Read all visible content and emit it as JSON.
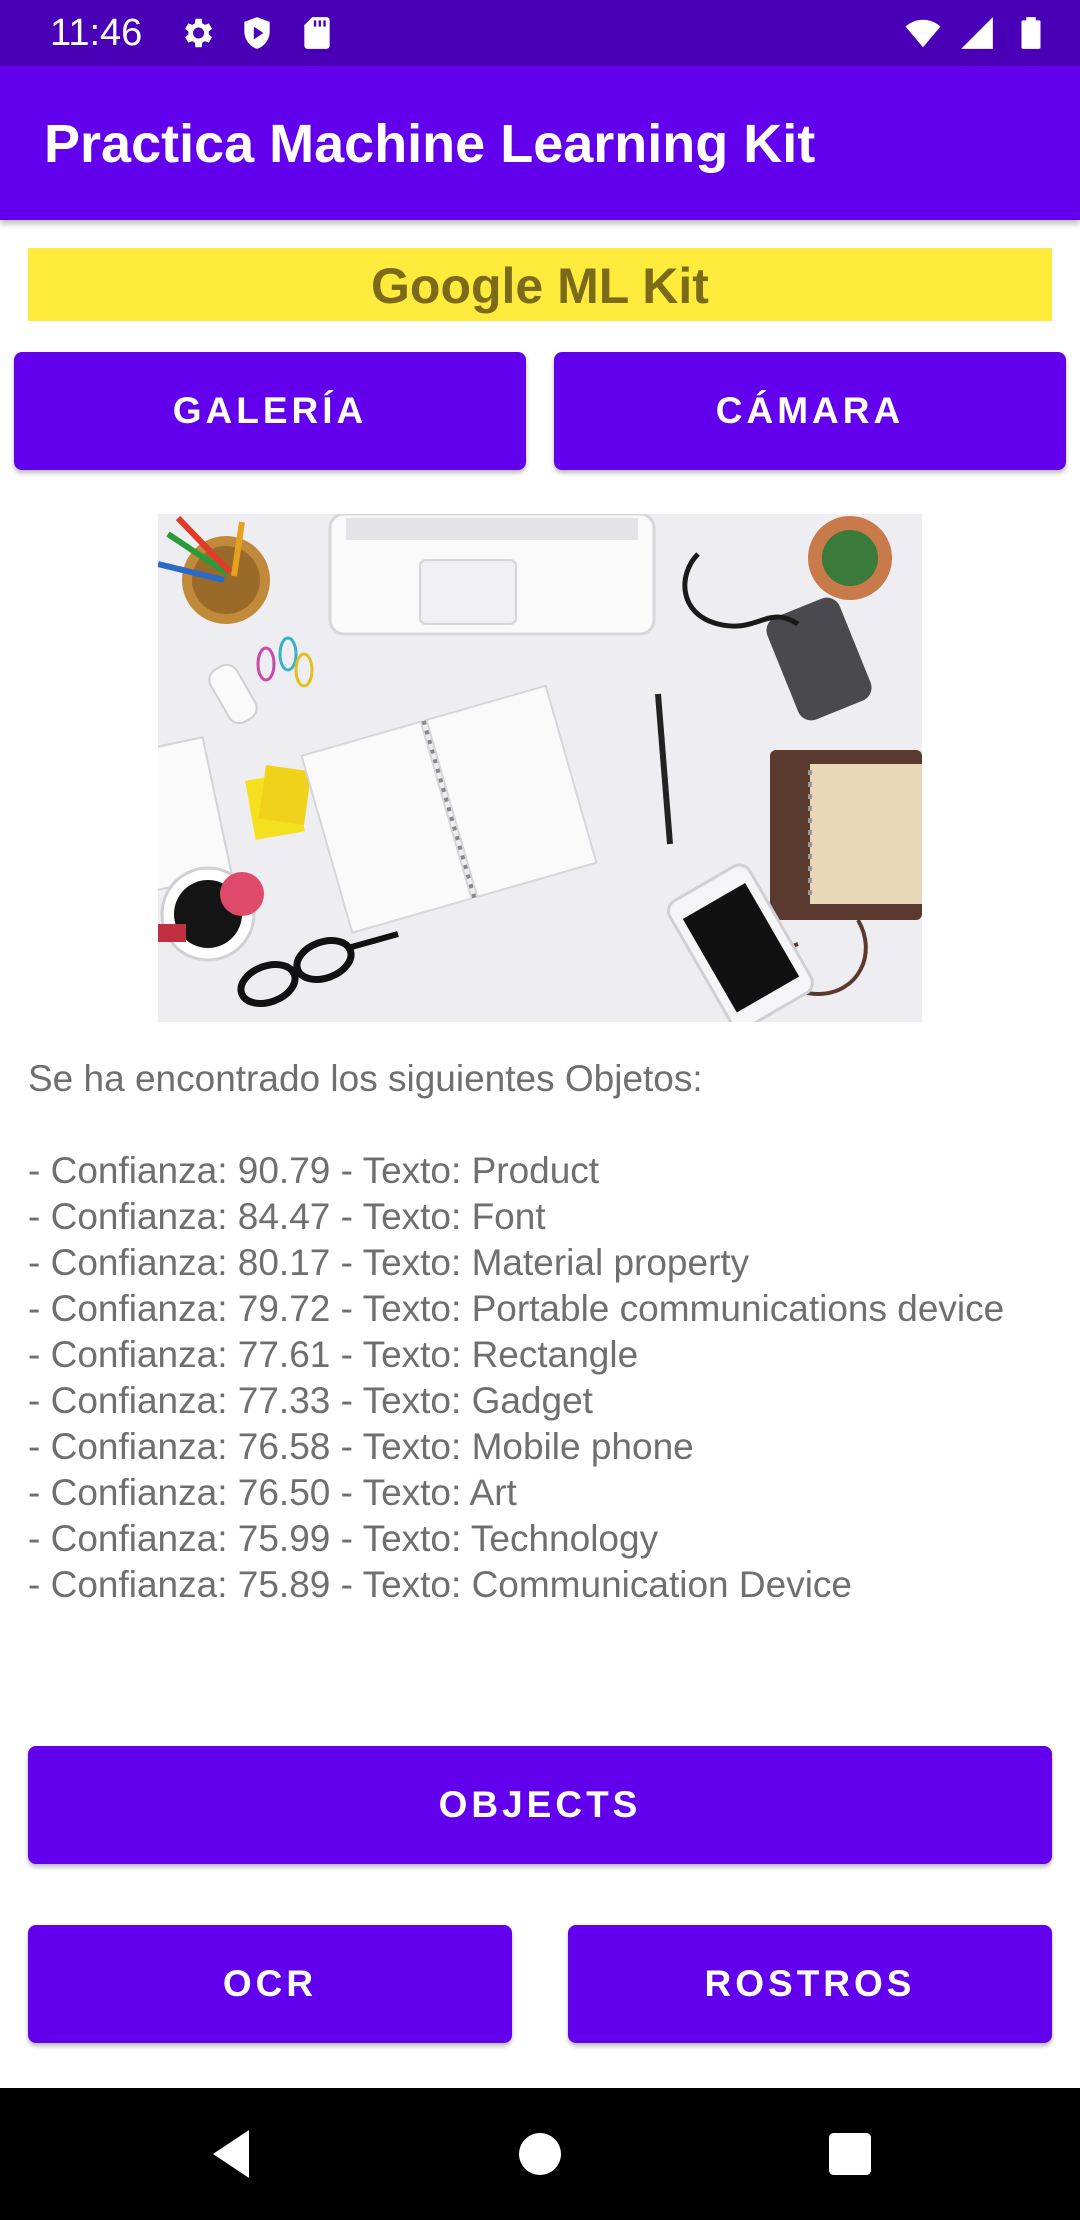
{
  "status_bar": {
    "time": "11:46",
    "left_icons": [
      "gear-icon",
      "shield-play-icon",
      "sd-card-icon"
    ],
    "right_icons": [
      "wifi-icon",
      "signal-icon",
      "battery-icon"
    ]
  },
  "app_bar": {
    "title": "Practica Machine Learning Kit"
  },
  "header": {
    "label": "Google ML Kit"
  },
  "source_buttons": {
    "gallery": "GALERÍA",
    "camera": "CÁMARA"
  },
  "results": {
    "intro": "Se ha encontrado los siguientes Objetos:",
    "lines": [
      "- Confianza: 90.79 - Texto: Product",
      "- Confianza: 84.47 - Texto: Font",
      "- Confianza: 80.17 - Texto: Material property",
      "- Confianza: 79.72 - Texto: Portable communications device",
      "- Confianza: 77.61 - Texto: Rectangle",
      "- Confianza: 77.33 - Texto: Gadget",
      "- Confianza: 76.58 - Texto: Mobile phone",
      "- Confianza: 76.50 - Texto: Art",
      "- Confianza: 75.99 - Texto: Technology",
      "- Confianza: 75.89 - Texto: Communication Device"
    ]
  },
  "action_buttons": {
    "objects": "OBJECTS",
    "ocr": "OCR",
    "faces": "ROSTROS"
  },
  "nav_bar": {
    "icons": [
      "back-icon",
      "home-icon",
      "recents-icon"
    ]
  },
  "colors": {
    "status_bar": "#4a00b6",
    "primary": "#6200ee",
    "header_bg": "#ffeb3b",
    "header_text": "#7a6a1a",
    "body_text": "#6f6f6f"
  }
}
